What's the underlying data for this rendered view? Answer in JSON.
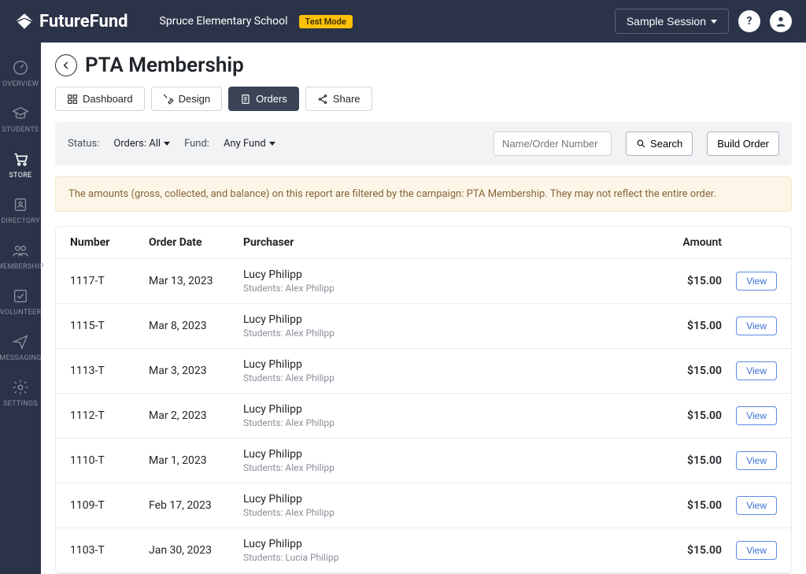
{
  "header": {
    "brand": "FutureFund",
    "school": "Spruce Elementary School",
    "test_badge": "Test Mode",
    "session_btn": "Sample Session"
  },
  "sidebar": {
    "items": [
      {
        "label": "OVERVIEW"
      },
      {
        "label": "STUDENTS"
      },
      {
        "label": "STORE"
      },
      {
        "label": "DIRECTORY"
      },
      {
        "label": "MEMBERSHIP"
      },
      {
        "label": "VOLUNTEER"
      },
      {
        "label": "MESSAGING"
      },
      {
        "label": "SETTINGS"
      }
    ]
  },
  "page": {
    "title": "PTA Membership",
    "tabs": {
      "dashboard": "Dashboard",
      "design": "Design",
      "orders": "Orders",
      "share": "Share"
    }
  },
  "filters": {
    "status_label": "Status:",
    "status_value": "Orders: All",
    "fund_label": "Fund:",
    "fund_value": "Any Fund",
    "search_placeholder": "Name/Order Number",
    "search_btn": "Search",
    "build_btn": "Build Order"
  },
  "alert": "The amounts (gross, collected, and balance) on this report are filtered by the campaign: PTA Membership. They may not reflect the entire order.",
  "table": {
    "headers": {
      "number": "Number",
      "date": "Order Date",
      "purchaser": "Purchaser",
      "amount": "Amount"
    },
    "view_label": "View",
    "rows": [
      {
        "number": "1117-T",
        "date": "Mar 13, 2023",
        "purchaser": "Lucy Philipp",
        "students": "Students: Alex Philipp",
        "amount": "$15.00"
      },
      {
        "number": "1115-T",
        "date": "Mar 8, 2023",
        "purchaser": "Lucy Philipp",
        "students": "Students: Alex Philipp",
        "amount": "$15.00"
      },
      {
        "number": "1113-T",
        "date": "Mar 3, 2023",
        "purchaser": "Lucy Philipp",
        "students": "Students: Alex Philipp",
        "amount": "$15.00"
      },
      {
        "number": "1112-T",
        "date": "Mar 2, 2023",
        "purchaser": "Lucy Philipp",
        "students": "Students: Alex Philipp",
        "amount": "$15.00"
      },
      {
        "number": "1110-T",
        "date": "Mar 1, 2023",
        "purchaser": "Lucy Philipp",
        "students": "Students: Alex Philipp",
        "amount": "$15.00"
      },
      {
        "number": "1109-T",
        "date": "Feb 17, 2023",
        "purchaser": "Lucy Philipp",
        "students": "Students: Alex Philipp",
        "amount": "$15.00"
      },
      {
        "number": "1103-T",
        "date": "Jan 30, 2023",
        "purchaser": "Lucy Philipp",
        "students": "Students: Lucia Philipp",
        "amount": "$15.00"
      }
    ]
  }
}
